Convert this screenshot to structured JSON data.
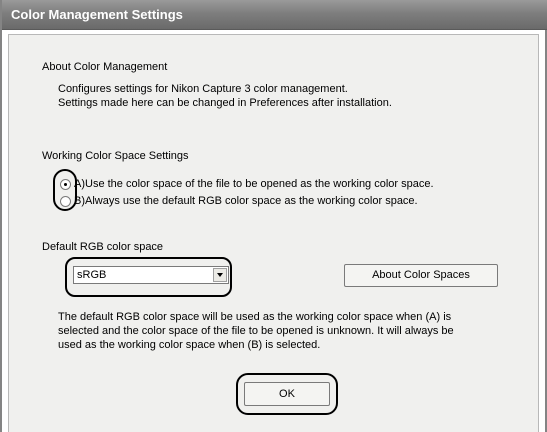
{
  "window": {
    "title": "Color Management Settings"
  },
  "about": {
    "heading": "About Color Management",
    "line1": "Configures settings for Nikon Capture 3 color management.",
    "line2": "Settings made here can be changed in Preferences after installation."
  },
  "working": {
    "heading": "Working Color Space Settings",
    "option_a": "A)Use the color space of the file to be opened as the working color space.",
    "option_b": "B)Always use the default RGB color space as the working color space.",
    "selected": "A"
  },
  "default_rgb": {
    "heading": "Default RGB color space",
    "selected_value": "sRGB",
    "about_button": "About Color Spaces",
    "desc_line1": "The default RGB color space will be used as the working color space when (A) is",
    "desc_line2": "selected and the color space of the file to be opened is unknown. It will always be",
    "desc_line3": "used as the working color space when (B) is selected."
  },
  "buttons": {
    "ok": "OK"
  },
  "icons": {
    "dropdown": "chevron-down-icon"
  },
  "colors": {
    "title_bar": "#7e7e7e",
    "title_text": "#ffffff",
    "client_bg": "#f0f0ee",
    "highlight": "#000000"
  }
}
